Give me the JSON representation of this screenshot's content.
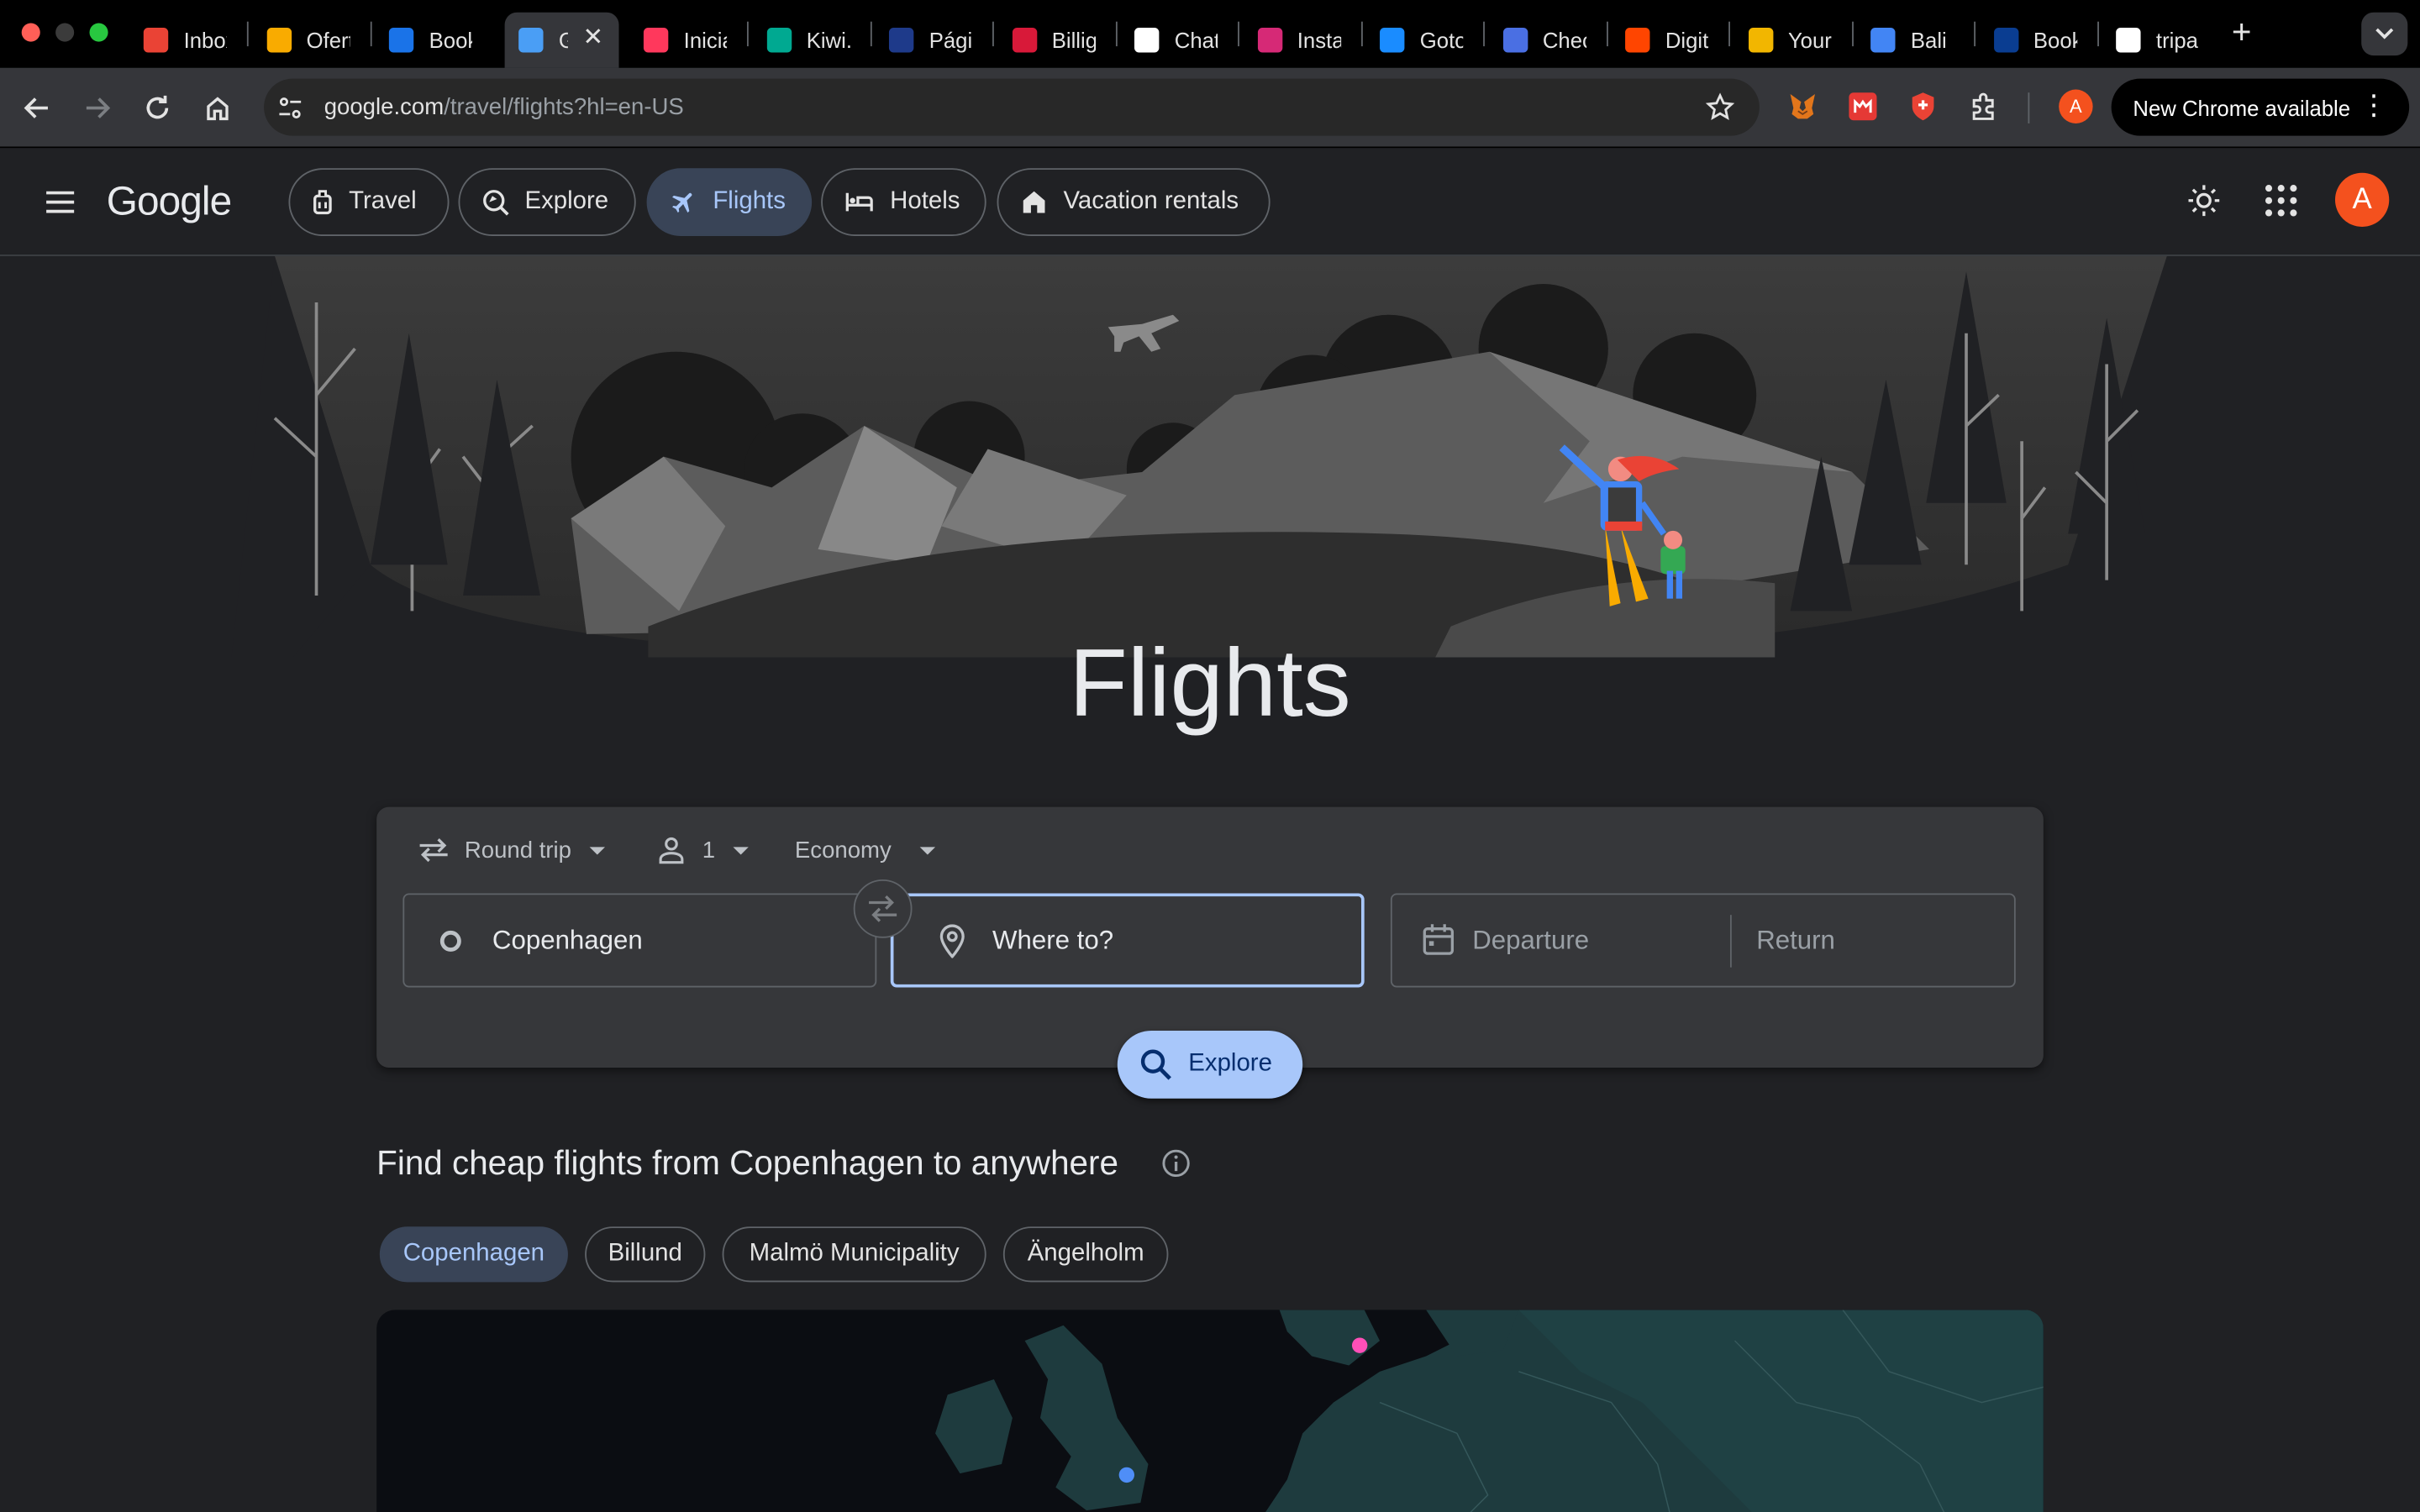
{
  "browser": {
    "tabs": [
      {
        "title": "Inbox",
        "icon": "gmail-icon",
        "color": "#ea4335"
      },
      {
        "title": "Ofertas",
        "icon": "ofertas-icon",
        "color": "#f9ab00"
      },
      {
        "title": "Booking",
        "icon": "booking-icon",
        "color": "#1a73e8"
      },
      {
        "title": "Google Flights",
        "icon": "flights-icon",
        "color": "#4a9ef5"
      },
      {
        "title": "Iniciar",
        "icon": "airbnb-icon",
        "color": "#ff385c"
      },
      {
        "title": "Kiwi.com",
        "icon": "kiwi-icon",
        "color": "#00a991"
      },
      {
        "title": "Página",
        "icon": "vueling-icon",
        "color": "#1e3a8a"
      },
      {
        "title": "Billig",
        "icon": "norwegian-icon",
        "color": "#d81939"
      },
      {
        "title": "ChatGPT",
        "icon": "chatgpt-icon",
        "color": "#ffffff"
      },
      {
        "title": "Instagram",
        "icon": "instagram-icon",
        "color": "#d62976"
      },
      {
        "title": "Gotogate",
        "icon": "gotogate-icon",
        "color": "#1a8cff"
      },
      {
        "title": "Check",
        "icon": "check-icon",
        "color": "#4a6fe3"
      },
      {
        "title": "Digit",
        "icon": "reddit-icon",
        "color": "#ff4500"
      },
      {
        "title": "Your",
        "icon": "your-icon",
        "color": "#f2b600"
      },
      {
        "title": "Bali",
        "icon": "docs-icon",
        "color": "#4285f4"
      },
      {
        "title": "Book",
        "icon": "book-icon",
        "color": "#0a3d91"
      },
      {
        "title": "tripa",
        "icon": "google-icon",
        "color": "#ffffff"
      }
    ],
    "url_host": "google.com",
    "url_path": "/travel/flights?hl=en-US",
    "profile_initial": "A",
    "update_label": "New Chrome available"
  },
  "app": {
    "logo": "Google",
    "nav": [
      {
        "label": "Travel",
        "icon": "suitcase-icon"
      },
      {
        "label": "Explore",
        "icon": "explore-icon"
      },
      {
        "label": "Flights",
        "icon": "airplane-icon",
        "active": true
      },
      {
        "label": "Hotels",
        "icon": "bed-icon"
      },
      {
        "label": "Vacation rentals",
        "icon": "house-icon"
      }
    ],
    "avatar_initial": "A"
  },
  "hero": {
    "title": "Flights"
  },
  "search": {
    "trip_type": "Round trip",
    "passengers": "1",
    "cabin_class": "Economy",
    "origin": "Copenhagen",
    "destination_placeholder": "Where to?",
    "departure_placeholder": "Departure",
    "return_placeholder": "Return",
    "explore_label": "Explore"
  },
  "cheap_flights": {
    "title": "Find cheap flights from Copenhagen to anywhere",
    "cities": [
      "Copenhagen",
      "Billund",
      "Malmö Municipality",
      "Ängelholm"
    ],
    "active_city": "Copenhagen"
  },
  "colors": {
    "accent": "#a8c7fa",
    "active_chip_bg": "#394457",
    "card_bg": "#36373a",
    "page_bg": "#202124"
  }
}
